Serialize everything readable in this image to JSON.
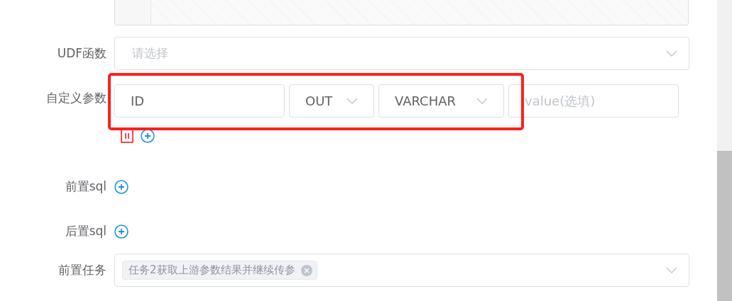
{
  "udf": {
    "label": "UDF函数",
    "placeholder": "请选择"
  },
  "custom_params": {
    "label": "自定义参数",
    "params": [
      {
        "name": "ID",
        "direction": "OUT",
        "type": "VARCHAR",
        "value_placeholder": "value(选填)"
      }
    ]
  },
  "pre_sql": {
    "label": "前置sql"
  },
  "post_sql": {
    "label": "后置sql"
  },
  "pre_tasks": {
    "label": "前置任务",
    "tags": [
      "任务2获取上游参数结果并继续传参"
    ]
  }
}
